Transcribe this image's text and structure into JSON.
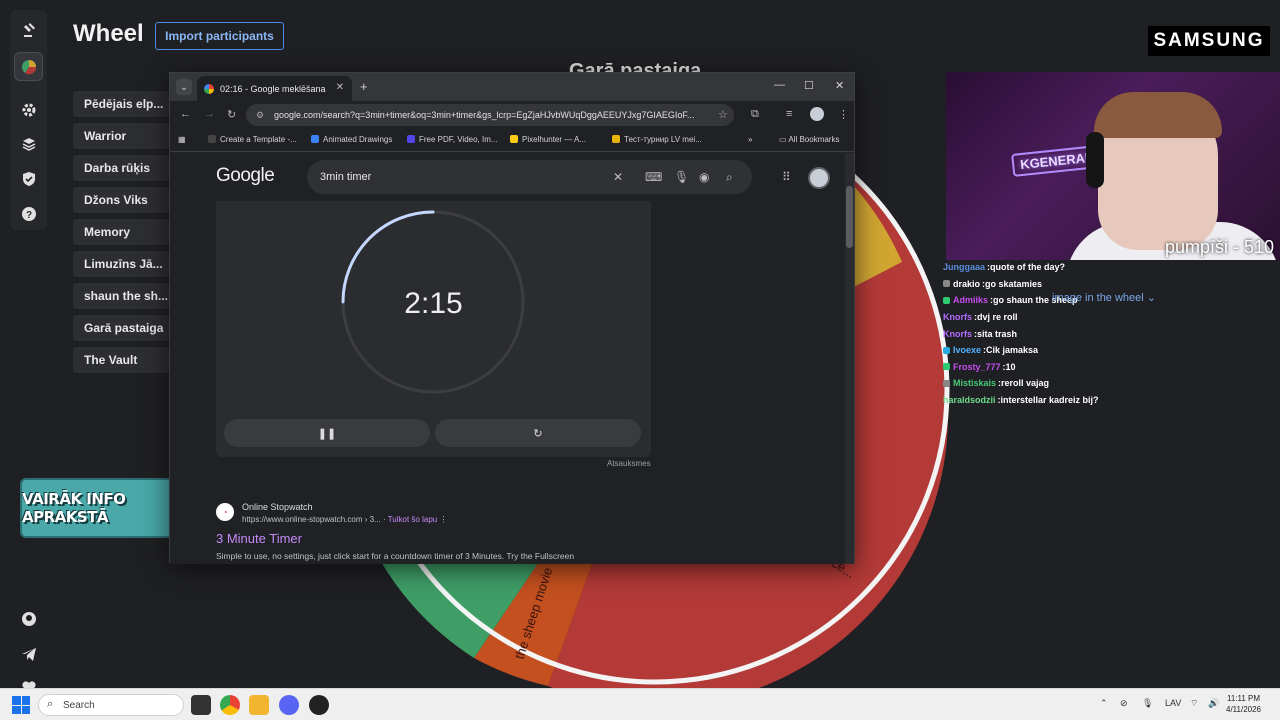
{
  "app": {
    "title": "Wheel",
    "import_label": "Import participants",
    "wheel_title": "Garā pastaiga",
    "participants": [
      "Pēdējais elp...",
      "Warrior",
      "Darba rūķis",
      "Džons Viks",
      "Memory",
      "Limuzīns Jā...",
      "shaun the sh...",
      "Garā pastaiga",
      "The Vault"
    ],
    "participant_extra": "1",
    "wheel_hint": "image in the wheel",
    "wheel_labels": [
      "the sheep movie",
      "ince..."
    ],
    "wheel_colors": {
      "red": "#b43a38",
      "green": "#3e9e66",
      "orange": "#c4501f",
      "yellow": "#d0a532"
    }
  },
  "rail_icons": [
    "gavel-icon",
    "wheel-icon",
    "settings-icon",
    "layers-icon",
    "shield-check-icon",
    "help-icon",
    "github-icon",
    "telegram-icon",
    "heart-icon"
  ],
  "overlay": {
    "banner": "VAIRĀK INFO APRAKSTĀ",
    "sponsor": "SAMSUNG",
    "webcam_neon": "KGENERALEXE",
    "webcam_caption": "pumpīši - 510"
  },
  "chat": [
    {
      "user": "Junggaaa",
      "msg": "quote of the day?",
      "color": "#5c8ddf",
      "badge": ""
    },
    {
      "user": "drakio",
      "msg": "go skatamies",
      "color": "#ffffff",
      "badge": "#888888"
    },
    {
      "user": "Admiiks",
      "msg": "go shaun the sheep",
      "color": "#c44df0",
      "badge": "#2ecc71"
    },
    {
      "user": "Knorfs",
      "msg": "dvj re roll",
      "color": "#b36bff",
      "badge": ""
    },
    {
      "user": "Knorfs",
      "msg": "sita trash",
      "color": "#b36bff",
      "badge": ""
    },
    {
      "user": "Ivoexe",
      "msg": "Cik jamaksa",
      "color": "#4fb3ff",
      "badge": "#2aa9e0"
    },
    {
      "user": "Frosty_777",
      "msg": "10",
      "color": "#c44df0",
      "badge": "#2ecc71"
    },
    {
      "user": "Mistiskais",
      "msg": "reroll vajag",
      "color": "#48c774",
      "badge": "#888888"
    },
    {
      "user": "haraldsodzii",
      "msg": "interstellar kadreiz bij?",
      "color": "#6fdc8c",
      "badge": ""
    }
  ],
  "browser": {
    "tab_title": "02:16 - Google meklēšana",
    "url": "google.com/search?q=3min+timer&oq=3min+timer&gs_lcrp=EgZjaHJvbWUqDggAEEUYJxg7GIAEGIoF...",
    "bookmarks": [
      {
        "label": "Create a Template -...",
        "color": "#444444"
      },
      {
        "label": "Animated Drawings",
        "color": "#3b82f6"
      },
      {
        "label": "Free PDF, Video, Im...",
        "color": "#4f46e5"
      },
      {
        "label": "Pixelhunter — A...",
        "color": "#facc15"
      },
      {
        "label": "Тест-турнир LV mei...",
        "color": "#eab308"
      }
    ],
    "all_bookmarks": "All Bookmarks",
    "google_logo": "Google",
    "search_query": "3min timer",
    "timer_value": "2:15",
    "timer_remaining_fraction": 0.75,
    "feedback": "Atsauksmes",
    "result": {
      "site": "Online Stopwatch",
      "url": "https://www.online-stopwatch.com › 3...",
      "translate": "Tulkot šo lapu",
      "title": "3 Minute Timer",
      "snippet": "Simple to use, no settings, just click start for a countdown timer of 3 Minutes. Try the Fullscreen"
    }
  },
  "taskbar": {
    "search_placeholder": "Search",
    "language": "LAV",
    "time": "11:11 PM",
    "date": "4/11/2026"
  }
}
